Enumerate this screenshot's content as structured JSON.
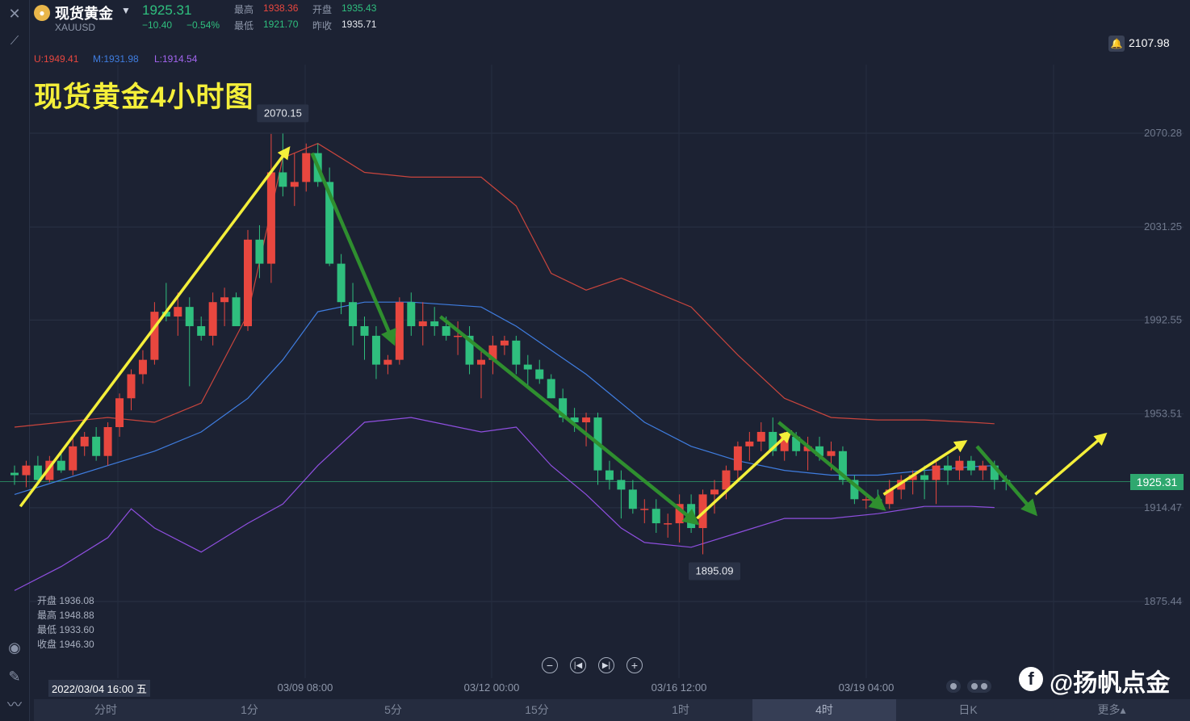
{
  "header": {
    "name": "现货黄金",
    "symbol": "XAUUSD",
    "price": "1925.31",
    "change": "−10.40",
    "change_pct": "−0.54%",
    "high_label": "最高",
    "high": "1938.36",
    "open_label": "开盘",
    "open": "1935.43",
    "low_label": "最低",
    "low": "1921.70",
    "prev_label": "昨收",
    "prev": "1935.71"
  },
  "boll": {
    "u": "U:1949.41",
    "m": "M:1931.98",
    "l": "L:1914.54"
  },
  "overlay_title": "现货黄金4小时图",
  "alert_value": "2107.98",
  "ohlc_panel": [
    "开盘 1936.08",
    "最高 1948.88",
    "最低 1933.60",
    "收盘 1946.30"
  ],
  "crosshair_date": "2022/03/04 16:00 五",
  "tabs": [
    "分时",
    "1分",
    "5分",
    "15分",
    "1时",
    "4时",
    "日K",
    "更多▴"
  ],
  "active_tab": "4时",
  "watermark": "@扬帆点金",
  "colors": {
    "up": "#e8473f",
    "down": "#2fbf7e",
    "upper": "#c9453d",
    "mid": "#3f7de0",
    "lower": "#8f4fe0",
    "arrow_up": "#f4ef3a",
    "arrow_down": "#2f8f2f"
  },
  "chart_data": {
    "type": "candlestick",
    "ylim": [
      1860.0,
      2100.0
    ],
    "y_ticks": [
      2070.28,
      2031.25,
      1992.55,
      1953.51,
      1914.47,
      1875.44
    ],
    "x_tick_labels": [
      "03/09 08:00",
      "03/12 00:00",
      "03/16 12:00",
      "03/19 04:00"
    ],
    "last_price": "1925.31",
    "high_marker": "2070.15",
    "low_marker": "1895.09",
    "candles": [
      [
        1929.0,
        1932.0,
        1924.0,
        1928.0
      ],
      [
        1928.0,
        1934.0,
        1923.0,
        1932.0
      ],
      [
        1932.0,
        1936.0,
        1924.0,
        1926.0
      ],
      [
        1926.0,
        1936.0,
        1925.0,
        1934.0
      ],
      [
        1934.0,
        1938.0,
        1929.0,
        1930.0
      ],
      [
        1930.0,
        1944.0,
        1928.0,
        1940.0
      ],
      [
        1940.0,
        1946.0,
        1936.0,
        1944.0
      ],
      [
        1944.0,
        1948.0,
        1934.0,
        1936.0
      ],
      [
        1936.0,
        1950.0,
        1932.0,
        1948.0
      ],
      [
        1948.0,
        1962.0,
        1944.0,
        1960.0
      ],
      [
        1960.0,
        1972.0,
        1955.0,
        1970.0
      ],
      [
        1970.0,
        1980.0,
        1966.0,
        1976.0
      ],
      [
        1976.0,
        2000.0,
        1974.0,
        1996.0
      ],
      [
        1996.0,
        2008.0,
        1992.0,
        1994.0
      ],
      [
        1994.0,
        2004.0,
        1986.0,
        1998.0
      ],
      [
        1998.0,
        2002.0,
        1965.0,
        1990.0
      ],
      [
        1990.0,
        1994.0,
        1984.0,
        1986.0
      ],
      [
        1986.0,
        2004.0,
        1982.0,
        2000.0
      ],
      [
        2000.0,
        2006.0,
        1990.0,
        2002.0
      ],
      [
        2002.0,
        2004.0,
        1990.0,
        1990.0
      ],
      [
        1990.0,
        2030.0,
        1988.0,
        2026.0
      ],
      [
        2026.0,
        2032.0,
        2010.0,
        2016.0
      ],
      [
        2016.0,
        2070.0,
        2008.0,
        2054.0
      ],
      [
        2054.0,
        2070.15,
        2044.0,
        2048.0
      ],
      [
        2048.0,
        2062.0,
        2040.0,
        2050.0
      ],
      [
        2050.0,
        2066.0,
        2046.0,
        2062.0
      ],
      [
        2062.0,
        2066.0,
        2048.0,
        2050.0
      ],
      [
        2050.0,
        2056.0,
        2015.0,
        2016.0
      ],
      [
        2016.0,
        2020.0,
        1995.0,
        2000.0
      ],
      [
        2000.0,
        2008.0,
        1982.0,
        1990.0
      ],
      [
        1990.0,
        1994.0,
        1976.0,
        1986.0
      ],
      [
        1986.0,
        1990.0,
        1968.0,
        1974.0
      ],
      [
        1974.0,
        1978.0,
        1970.0,
        1976.0
      ],
      [
        1976.0,
        2002.0,
        1974.0,
        2000.0
      ],
      [
        2000.0,
        2004.0,
        1986.0,
        1990.0
      ],
      [
        1990.0,
        2000.0,
        1982.0,
        1992.0
      ],
      [
        1992.0,
        1998.0,
        1986.0,
        1990.0
      ],
      [
        1990.0,
        1994.0,
        1984.0,
        1986.0
      ],
      [
        1986.0,
        1992.0,
        1978.0,
        1986.0
      ],
      [
        1986.0,
        1990.0,
        1970.0,
        1974.0
      ],
      [
        1974.0,
        1980.0,
        1960.0,
        1976.0
      ],
      [
        1976.0,
        1986.0,
        1970.0,
        1982.0
      ],
      [
        1982.0,
        1986.0,
        1978.0,
        1984.0
      ],
      [
        1984.0,
        1986.0,
        1970.0,
        1974.0
      ],
      [
        1974.0,
        1978.0,
        1964.0,
        1972.0
      ],
      [
        1972.0,
        1976.0,
        1966.0,
        1968.0
      ],
      [
        1968.0,
        1970.0,
        1960.0,
        1960.0
      ],
      [
        1960.0,
        1964.0,
        1950.0,
        1952.0
      ],
      [
        1952.0,
        1956.0,
        1946.0,
        1950.0
      ],
      [
        1950.0,
        1954.0,
        1940.0,
        1952.0
      ],
      [
        1952.0,
        1954.0,
        1924.0,
        1930.0
      ],
      [
        1930.0,
        1934.0,
        1922.0,
        1926.0
      ],
      [
        1926.0,
        1930.0,
        1910.0,
        1922.0
      ],
      [
        1922.0,
        1926.0,
        1912.0,
        1914.0
      ],
      [
        1914.0,
        1918.0,
        1908.0,
        1914.0
      ],
      [
        1914.0,
        1918.0,
        1904.0,
        1908.0
      ],
      [
        1908.0,
        1912.0,
        1902.0,
        1908.0
      ],
      [
        1908.0,
        1920.0,
        1900.0,
        1916.0
      ],
      [
        1916.0,
        1920.0,
        1904.0,
        1906.0
      ],
      [
        1906.0,
        1922.0,
        1895.09,
        1920.0
      ],
      [
        1920.0,
        1926.0,
        1912.0,
        1922.0
      ],
      [
        1922.0,
        1932.0,
        1918.0,
        1930.0
      ],
      [
        1930.0,
        1942.0,
        1926.0,
        1940.0
      ],
      [
        1940.0,
        1946.0,
        1934.0,
        1942.0
      ],
      [
        1942.0,
        1950.0,
        1938.0,
        1946.0
      ],
      [
        1946.0,
        1952.0,
        1936.0,
        1938.0
      ],
      [
        1938.0,
        1946.0,
        1934.0,
        1944.0
      ],
      [
        1944.0,
        1946.0,
        1936.0,
        1938.0
      ],
      [
        1938.0,
        1944.0,
        1930.0,
        1940.0
      ],
      [
        1940.0,
        1944.0,
        1934.0,
        1936.0
      ],
      [
        1936.0,
        1942.0,
        1930.0,
        1938.0
      ],
      [
        1938.0,
        1940.0,
        1924.0,
        1926.0
      ],
      [
        1926.0,
        1928.0,
        1916.0,
        1918.0
      ],
      [
        1918.0,
        1920.0,
        1914.0,
        1918.0
      ],
      [
        1918.0,
        1922.0,
        1914.0,
        1916.0
      ],
      [
        1916.0,
        1926.0,
        1914.0,
        1922.0
      ],
      [
        1922.0,
        1928.0,
        1918.0,
        1926.0
      ],
      [
        1926.0,
        1930.0,
        1920.0,
        1928.0
      ],
      [
        1928.0,
        1932.0,
        1918.0,
        1926.0
      ],
      [
        1926.0,
        1934.0,
        1916.0,
        1932.0
      ],
      [
        1932.0,
        1936.0,
        1924.0,
        1930.0
      ],
      [
        1930.0,
        1936.0,
        1926.0,
        1934.0
      ],
      [
        1934.0,
        1936.0,
        1928.0,
        1930.0
      ],
      [
        1930.0,
        1934.0,
        1926.0,
        1932.0
      ],
      [
        1932.0,
        1934.0,
        1922.0,
        1926.0
      ],
      [
        1926.0,
        1928.0,
        1921.7,
        1925.31
      ]
    ],
    "boll_upper": [
      [
        0,
        1948.0
      ],
      [
        4,
        1950.0
      ],
      [
        8,
        1952.0
      ],
      [
        12,
        1950.0
      ],
      [
        16,
        1958.0
      ],
      [
        20,
        1995.0
      ],
      [
        23,
        2060.0
      ],
      [
        26,
        2066.0
      ],
      [
        30,
        2054.0
      ],
      [
        34,
        2052.0
      ],
      [
        40,
        2052.0
      ],
      [
        43,
        2040.0
      ],
      [
        46,
        2012.0
      ],
      [
        49,
        2005.0
      ],
      [
        52,
        2010.0
      ],
      [
        54,
        2006.0
      ],
      [
        58,
        1998.0
      ],
      [
        62,
        1978.0
      ],
      [
        66,
        1960.0
      ],
      [
        70,
        1952.0
      ],
      [
        74,
        1951.0
      ],
      [
        78,
        1951.0
      ],
      [
        82,
        1950.0
      ],
      [
        84,
        1949.41
      ]
    ],
    "boll_mid": [
      [
        0,
        1920.0
      ],
      [
        4,
        1926.0
      ],
      [
        8,
        1932.0
      ],
      [
        12,
        1938.0
      ],
      [
        16,
        1946.0
      ],
      [
        20,
        1960.0
      ],
      [
        23,
        1976.0
      ],
      [
        26,
        1996.0
      ],
      [
        30,
        2000.0
      ],
      [
        34,
        2000.0
      ],
      [
        40,
        1998.0
      ],
      [
        43,
        1990.0
      ],
      [
        46,
        1980.0
      ],
      [
        49,
        1970.0
      ],
      [
        52,
        1958.0
      ],
      [
        54,
        1950.0
      ],
      [
        58,
        1940.0
      ],
      [
        62,
        1934.0
      ],
      [
        66,
        1930.0
      ],
      [
        70,
        1928.0
      ],
      [
        74,
        1928.0
      ],
      [
        78,
        1930.0
      ],
      [
        82,
        1931.5
      ],
      [
        84,
        1931.98
      ]
    ],
    "boll_lower": [
      [
        0,
        1880.0
      ],
      [
        4,
        1890.0
      ],
      [
        8,
        1902.0
      ],
      [
        10,
        1914.0
      ],
      [
        12,
        1906.0
      ],
      [
        16,
        1896.0
      ],
      [
        20,
        1908.0
      ],
      [
        23,
        1916.0
      ],
      [
        26,
        1932.0
      ],
      [
        30,
        1950.0
      ],
      [
        34,
        1952.0
      ],
      [
        40,
        1946.0
      ],
      [
        43,
        1948.0
      ],
      [
        46,
        1932.0
      ],
      [
        49,
        1920.0
      ],
      [
        52,
        1906.0
      ],
      [
        54,
        1900.0
      ],
      [
        58,
        1898.0
      ],
      [
        62,
        1904.0
      ],
      [
        66,
        1910.0
      ],
      [
        70,
        1910.0
      ],
      [
        74,
        1912.0
      ],
      [
        78,
        1915.0
      ],
      [
        82,
        1915.0
      ],
      [
        84,
        1914.54
      ]
    ],
    "arrows": [
      {
        "dir": "up",
        "from": [
          0.5,
          1915.0
        ],
        "to": [
          23.5,
          2064.0
        ]
      },
      {
        "dir": "down",
        "from": [
          25.5,
          2062.0
        ],
        "to": [
          32.5,
          1983.0
        ]
      },
      {
        "dir": "down",
        "from": [
          36.5,
          1994.0
        ],
        "to": [
          58.5,
          1908.0
        ]
      },
      {
        "dir": "up",
        "from": [
          58.5,
          1910.0
        ],
        "to": [
          66.5,
          1946.0
        ]
      },
      {
        "dir": "down",
        "from": [
          65.5,
          1950.0
        ],
        "to": [
          74.5,
          1914.0
        ]
      },
      {
        "dir": "up",
        "from": [
          74.5,
          1920.0
        ],
        "to": [
          81.5,
          1942.0
        ]
      },
      {
        "dir": "down",
        "from": [
          82.5,
          1940.0
        ],
        "to": [
          87.5,
          1912.0
        ]
      },
      {
        "dir": "up",
        "from": [
          87.5,
          1920.0
        ],
        "to": [
          93.5,
          1945.0
        ]
      }
    ]
  }
}
